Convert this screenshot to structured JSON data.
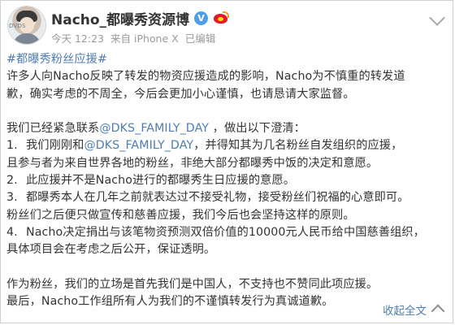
{
  "header": {
    "avatar_text": "DVDS",
    "username": "Nacho_都曝秀资源博",
    "verified_label": "V",
    "timestamp": "今天 12:23",
    "source": "来自 iPhone X",
    "edited": "已编辑"
  },
  "post": {
    "hashtag": "#都曝秀粉丝应援#",
    "lines": [
      "许多人向Nacho反映了转发的物资应援造成的影响，Nacho为不慎重的转发道",
      "歉，确实考虑的不周全，今后会更加小心谨慎，也请恳请大家监督。",
      "",
      "我们已经紧急联系@DKS_FAMILY_DAY ，做出以下澄清："
    ],
    "mention": "@DKS_FAMILY_DAY",
    "items": [
      {
        "num": "1.",
        "pre": "我们刚刚和",
        "mention": "@DKS_FAMILY_DAY",
        "post": "，并得知其为几名粉丝自发组织的应援，"
      },
      {
        "num": "",
        "pre": "且参与者为来自世界各地的粉丝，非绝大部分都曝秀中饭的决定和意愿。",
        "mention": "",
        "post": ""
      },
      {
        "num": "2.",
        "pre": "此应援并不是Nacho进行的都曝秀生日应援的意愿。",
        "mention": "",
        "post": ""
      },
      {
        "num": "3.",
        "pre": "都曝秀本人在几年之前就表达过不接受礼物，接受粉丝们祝福的心意即可。",
        "mention": "",
        "post": ""
      },
      {
        "num": "",
        "pre": "粉丝们之后便只做宣传和慈善应援，我们今后也会坚持这样的原则。",
        "mention": "",
        "post": ""
      },
      {
        "num": "4.",
        "pre": "Nacho决定捐出与该笔物资预测双倍价值的10000元人民币给中国慈善组织，",
        "mention": "",
        "post": ""
      },
      {
        "num": "",
        "pre": "具体项目会在考虑之后公开，保证透明。",
        "mention": "",
        "post": ""
      }
    ],
    "closing": [
      "作为粉丝，我们的立场是首先我们是中国人，不支持也不赞同此项应援。",
      "最后，Nacho工作组所有人为我们的不谨慎转发行为真诚道歉。"
    ]
  },
  "footer": {
    "collapse_label": "收起全文"
  },
  "colors": {
    "link": "#507daf",
    "text": "#333333",
    "meta": "#9a9a9a",
    "verified": "#4e9ee8"
  }
}
